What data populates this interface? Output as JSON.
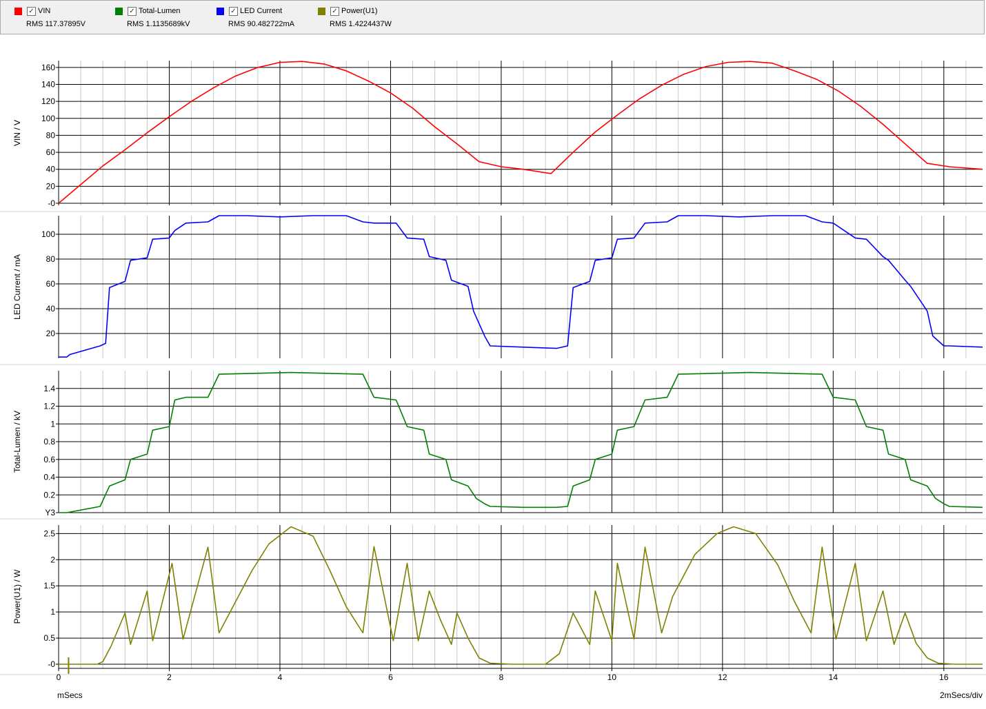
{
  "legend": [
    {
      "name": "VIN",
      "color": "#ff0000",
      "rms": "RMS  117.37895V"
    },
    {
      "name": "Total-Lumen",
      "color": "#008000",
      "rms": "RMS  1.1135689kV"
    },
    {
      "name": "LED Current",
      "color": "#0000ff",
      "rms": "RMS  90.482722mA"
    },
    {
      "name": "Power(U1)",
      "color": "#808000",
      "rms": "RMS  1.4224437W"
    }
  ],
  "x_axis": {
    "ticks": [
      "0",
      "2",
      "4",
      "6",
      "8",
      "10",
      "12",
      "14",
      "16"
    ],
    "unit_label": "mSecs",
    "scale_label": "2mSecs/div",
    "range": [
      0,
      16.7
    ]
  },
  "chart_data": [
    {
      "type": "line",
      "ylabel": "VIN / V",
      "ylim": [
        0,
        168
      ],
      "yticks": [
        "-0",
        "20",
        "40",
        "60",
        "80",
        "100",
        "120",
        "140",
        "160"
      ],
      "series": [
        {
          "name": "VIN",
          "color": "#ff0000",
          "x": [
            0,
            0.4,
            0.8,
            1.2,
            1.6,
            2.0,
            2.4,
            2.8,
            3.2,
            3.6,
            4.0,
            4.4,
            4.8,
            5.2,
            5.6,
            6.0,
            6.4,
            6.8,
            7.2,
            7.6,
            8.0,
            8.4,
            8.9,
            9.3,
            9.7,
            10.1,
            10.5,
            10.9,
            11.3,
            11.7,
            12.1,
            12.5,
            12.9,
            13.3,
            13.7,
            14.1,
            14.5,
            14.9,
            15.3,
            15.7,
            16.1,
            16.7
          ],
          "values": [
            0,
            22,
            44,
            63,
            83,
            102,
            120,
            136,
            150,
            160,
            166,
            167,
            164,
            156,
            144,
            130,
            112,
            90,
            70,
            49,
            43,
            40,
            35,
            60,
            84,
            104,
            123,
            139,
            152,
            161,
            166,
            167,
            165,
            156,
            146,
            132,
            114,
            93,
            70,
            47,
            43,
            40
          ]
        }
      ]
    },
    {
      "type": "line",
      "ylabel": "LED Current / mA",
      "ylim": [
        0,
        115
      ],
      "yticks": [
        "20",
        "40",
        "60",
        "80",
        "100"
      ],
      "series": [
        {
          "name": "LED Current",
          "color": "#0000ff",
          "x": [
            0,
            0.15,
            0.2,
            0.75,
            0.85,
            0.92,
            1.2,
            1.3,
            1.6,
            1.7,
            2.0,
            2.1,
            2.3,
            2.7,
            2.9,
            3.4,
            4.0,
            4.6,
            5.2,
            5.5,
            5.7,
            6.1,
            6.3,
            6.6,
            6.7,
            7.0,
            7.1,
            7.4,
            7.5,
            7.7,
            7.8,
            8.4,
            9.0,
            9.2,
            9.3,
            9.6,
            9.7,
            10.0,
            10.1,
            10.4,
            10.6,
            11.0,
            11.2,
            11.7,
            12.3,
            12.9,
            13.5,
            13.8,
            14.0,
            14.4,
            14.6,
            14.9,
            15.0,
            15.3,
            15.4,
            15.7,
            15.8,
            16.0,
            16.1,
            16.7
          ],
          "values": [
            1,
            1,
            3,
            10,
            12,
            57,
            62,
            79,
            81,
            96,
            97,
            103,
            109,
            110,
            115,
            115,
            114,
            115,
            115,
            110,
            109,
            109,
            97,
            96,
            82,
            79,
            63,
            58,
            38,
            18,
            10,
            9,
            8,
            10,
            57,
            62,
            79,
            81,
            96,
            97,
            109,
            110,
            115,
            115,
            114,
            115,
            115,
            110,
            109,
            97,
            96,
            82,
            79,
            63,
            58,
            38,
            18,
            10,
            10,
            9
          ]
        }
      ]
    },
    {
      "type": "line",
      "ylabel": "Total-Lumen / kV",
      "ylim": [
        0,
        1.6
      ],
      "yticks": [
        "Y3",
        "0.2",
        "0.4",
        "0.6",
        "0.8",
        "1",
        "1.2",
        "1.4"
      ],
      "series": [
        {
          "name": "Total-Lumen",
          "color": "#008000",
          "x": [
            0,
            0.15,
            0.75,
            0.92,
            1.2,
            1.3,
            1.6,
            1.7,
            2.0,
            2.1,
            2.3,
            2.7,
            2.9,
            4.2,
            5.5,
            5.7,
            6.1,
            6.3,
            6.6,
            6.7,
            7.0,
            7.1,
            7.4,
            7.55,
            7.7,
            7.8,
            8.4,
            9.0,
            9.2,
            9.3,
            9.6,
            9.7,
            10.0,
            10.1,
            10.4,
            10.6,
            11.0,
            11.2,
            12.5,
            13.8,
            14.0,
            14.4,
            14.6,
            14.9,
            15.0,
            15.3,
            15.4,
            15.7,
            15.85,
            16.0,
            16.1,
            16.7
          ],
          "values": [
            0,
            0,
            0.07,
            0.3,
            0.37,
            0.6,
            0.66,
            0.93,
            0.97,
            1.27,
            1.3,
            1.3,
            1.56,
            1.58,
            1.56,
            1.3,
            1.27,
            0.97,
            0.93,
            0.66,
            0.6,
            0.37,
            0.3,
            0.16,
            0.1,
            0.07,
            0.06,
            0.06,
            0.07,
            0.3,
            0.37,
            0.6,
            0.66,
            0.93,
            0.97,
            1.27,
            1.3,
            1.56,
            1.58,
            1.56,
            1.3,
            1.27,
            0.97,
            0.93,
            0.66,
            0.6,
            0.37,
            0.3,
            0.16,
            0.1,
            0.07,
            0.06
          ]
        }
      ]
    },
    {
      "type": "line",
      "ylabel": "Power(U1) / W",
      "ylim": [
        0,
        2.65
      ],
      "yticks": [
        "-0",
        "0.5",
        "1",
        "1.5",
        "2",
        "2.5"
      ],
      "series": [
        {
          "name": "Power(U1)",
          "color": "#808000",
          "x": [
            0,
            0.7,
            0.8,
            0.95,
            1.2,
            1.3,
            1.6,
            1.7,
            2.05,
            2.25,
            2.7,
            2.9,
            3.2,
            3.5,
            3.8,
            4.2,
            4.6,
            4.9,
            5.2,
            5.5,
            5.7,
            6.05,
            6.3,
            6.5,
            6.7,
            6.9,
            7.1,
            7.2,
            7.4,
            7.6,
            7.8,
            8.2,
            8.8,
            9.05,
            9.3,
            9.6,
            9.7,
            10.0,
            10.1,
            10.4,
            10.6,
            10.9,
            11.1,
            11.5,
            11.9,
            12.2,
            12.6,
            13.0,
            13.3,
            13.6,
            13.8,
            14.05,
            14.4,
            14.6,
            14.9,
            15.1,
            15.3,
            15.5,
            15.7,
            15.9,
            16.2,
            16.7
          ],
          "values": [
            0,
            0,
            0.05,
            0.35,
            0.98,
            0.38,
            1.4,
            0.45,
            1.93,
            0.48,
            2.24,
            0.6,
            1.2,
            1.8,
            2.3,
            2.63,
            2.45,
            1.8,
            1.1,
            0.6,
            2.25,
            0.45,
            1.93,
            0.45,
            1.4,
            0.85,
            0.38,
            0.98,
            0.5,
            0.12,
            0.02,
            0,
            0,
            0.2,
            0.98,
            0.38,
            1.4,
            0.45,
            1.93,
            0.48,
            2.24,
            0.6,
            1.3,
            2.1,
            2.5,
            2.63,
            2.5,
            1.9,
            1.2,
            0.6,
            2.24,
            0.48,
            1.93,
            0.45,
            1.4,
            0.38,
            0.98,
            0.4,
            0.12,
            0.02,
            0,
            0
          ]
        }
      ]
    }
  ]
}
